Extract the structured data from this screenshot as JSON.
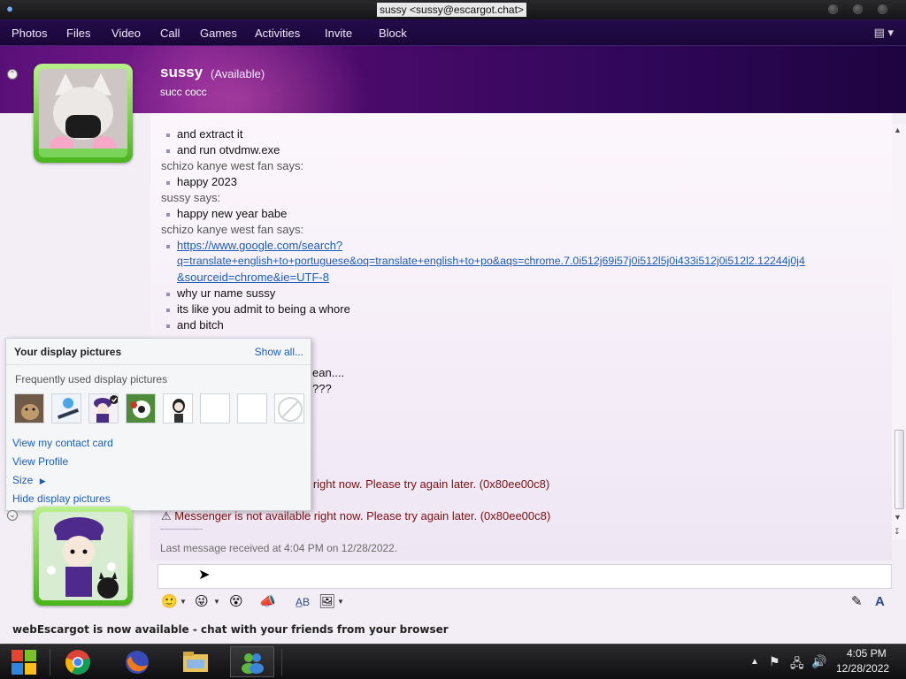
{
  "window": {
    "title": "sussy <sussy@escargot.chat>"
  },
  "menu": {
    "items": [
      "Photos",
      "Files",
      "Video",
      "Call",
      "Games",
      "Activities",
      "Invite",
      "Block"
    ]
  },
  "contact": {
    "name": "sussy",
    "status": "(Available)",
    "personal_message": "succ cocc"
  },
  "chat": {
    "lines": [
      {
        "type": "msg",
        "text": "and extract it"
      },
      {
        "type": "msg",
        "text": "and run otvdmw.exe"
      },
      {
        "type": "sender",
        "text": "schizo kanye west fan says:"
      },
      {
        "type": "msg",
        "text": "happy 2023"
      },
      {
        "type": "sender",
        "text": "sussy says:"
      },
      {
        "type": "msg",
        "text": "happy new year babe"
      },
      {
        "type": "sender",
        "text": "schizo kanye west fan says:"
      },
      {
        "type": "link",
        "text": "https://www.google.com/search?"
      },
      {
        "type": "link-cont",
        "text": "q=translate+english+to+portuguese&oq=translate+english+to+po&aqs=chrome.7.0i512j69i57j0i512l5j0i433i512j0i512l2.12244j0j4"
      },
      {
        "type": "link-cont",
        "text": "&sourceid=chrome&ie=UTF-8"
      },
      {
        "type": "msg",
        "text": "why ur name sussy"
      },
      {
        "type": "msg",
        "text": "its like you admit to being a whore"
      },
      {
        "type": "msg",
        "text": "and bitch"
      }
    ],
    "partial_1": "ean....",
    "partial_2": "???",
    "error_partial": "e right now. Please try again later. (0x80ee00c8)",
    "error_full": "Messenger is not available right now. Please try again later. (0x80ee00c8)",
    "last_message": "Last message received at 4:04 PM on 12/28/2022."
  },
  "display_pictures": {
    "title": "Your display pictures",
    "show_all": "Show all...",
    "frequent_label": "Frequently used display pictures",
    "links": [
      "View my contact card",
      "View Profile",
      "Size",
      "Hide display pictures"
    ]
  },
  "status_bar": {
    "text": "webEscargot is now available - chat with your friends from your browser"
  },
  "taskbar": {
    "time": "4:05 PM",
    "date": "12/28/2022"
  }
}
